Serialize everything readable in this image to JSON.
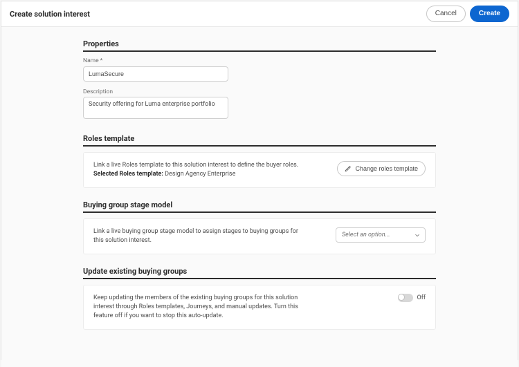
{
  "header": {
    "title": "Create solution interest",
    "cancel_label": "Cancel",
    "create_label": "Create"
  },
  "properties": {
    "heading": "Properties",
    "name_label": "Name",
    "name_value": "LumaSecure",
    "description_label": "Description",
    "description_value": "Security offering for Luma enterprise portfolio"
  },
  "roles_template": {
    "heading": "Roles template",
    "body": "Link a live Roles template to this solution interest to define the buyer roles.",
    "selected_label": "Selected Roles template:",
    "selected_value": "Design Agency Enterprise",
    "button": "Change roles template"
  },
  "stage_model": {
    "heading": "Buying group stage model",
    "body": "Link a live buying group stage model to assign stages to buying groups for this solution interest.",
    "select_placeholder": "Select an option..."
  },
  "update_groups": {
    "heading": "Update existing buying groups",
    "body": "Keep updating the members of the existing buying groups for this solution interest through Roles templates, Journeys, and manual updates. Turn this feature off if you want to stop this auto-update.",
    "toggle_state": "Off"
  }
}
